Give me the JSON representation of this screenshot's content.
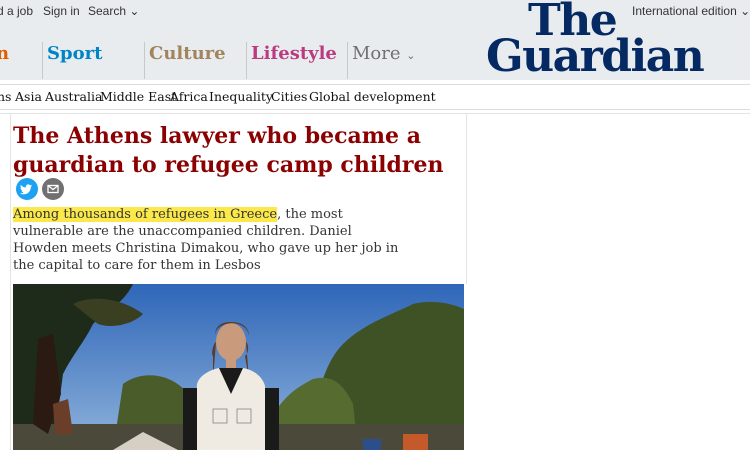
{
  "masthead": {
    "top_links": [
      "d a job",
      "Sign in",
      "Search"
    ],
    "edition_label": "International edition",
    "logo_line1": "The",
    "logo_line2": "Guardian"
  },
  "pillars": [
    {
      "label": "n",
      "color": "#e05e00"
    },
    {
      "label": "Sport",
      "color": "#0084c6"
    },
    {
      "label": "Culture",
      "color": "#a1845c"
    },
    {
      "label": "Lifestyle",
      "color": "#bb3b80"
    },
    {
      "label": "More",
      "color": "#707070"
    }
  ],
  "subnav": [
    "ns",
    "Asia",
    "Australia",
    "Middle East",
    "Africa",
    "Inequality",
    "Cities",
    "Global development"
  ],
  "article": {
    "headline": "The Athens lawyer who became a guardian to refugee camp children",
    "standfirst_highlight": "Among thousands of refugees in Greece",
    "standfirst_rest": ", the most vulnerable are the unaccompanied children. Daniel Howden meets Christina Dimakou, who gave up her job in the capital to care for them in Lesbos"
  },
  "colors": {
    "masthead_bg": "#e9ecef",
    "logo": "#052962",
    "headline": "#8b0000",
    "highlight": "#fbe84b",
    "twitter": "#1da1f2",
    "email": "#707070"
  }
}
